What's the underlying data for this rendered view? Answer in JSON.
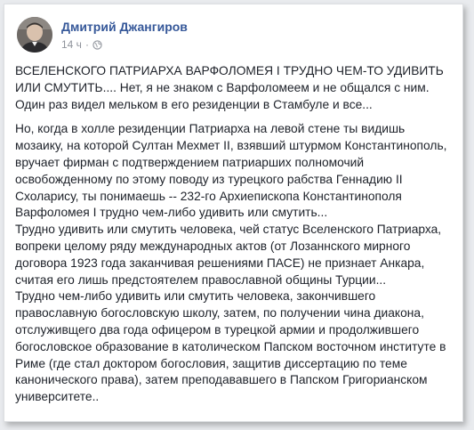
{
  "post": {
    "author_name": "Дмитрий Джангиров",
    "timestamp": "14 ч",
    "separator": "·",
    "privacy_icon": "globe-icon",
    "avatar_icon": "profile-photo",
    "paragraph_1": "ВСЕЛЕНСКОГО ПАТРИАРХА ВАРФОЛОМЕЯ I ТРУДНО ЧЕМ-ТО УДИВИТЬ ИЛИ СМУТИТЬ.... Нет, я не знаком с Варфоломеем и не общался с ним. Один раз видел мельком в его резиденции в Стамбуле и все...",
    "paragraph_2": "Но, когда в холле резиденции Патриарха на левой стене ты видишь мозаику, на которой Султан Мехмет II, взявший штурмом Константинополь, вручает фирман с подтверждением патриарших полномочий освобожденному по этому поводу из турецкого рабства Геннадию II Схоларису, ты понимаешь -- 232-го Архиепископа Константинополя Варфоломея I трудно чем-либо удивить или смутить...",
    "paragraph_3": "Трудно удивить или смутить человека, чей статус Вселенского Патриарха, вопреки целому ряду международных актов (от Лозаннского мирного договора 1923 года заканчивая решениями ПАСЕ) не признает Анкара, считая его лишь предстоятелем православной общины Турции...",
    "paragraph_4": "Трудно чем-либо удивить или смутить человека, закончившего православную богословскую школу, затем, по получении чина диакона, отслуживщего два года офицером в турецкой армии и продолжившего богословское образование в католическом Папском восточном институте в Риме (где стал доктором богословия, защитив диссертацию по теме канонического права), затем преподававшего в Папском Григорианском университете.."
  },
  "colors": {
    "author_link": "#365899",
    "meta_text": "#90949c",
    "body_text": "#1d2129",
    "page_bg": "#e9ebee"
  }
}
